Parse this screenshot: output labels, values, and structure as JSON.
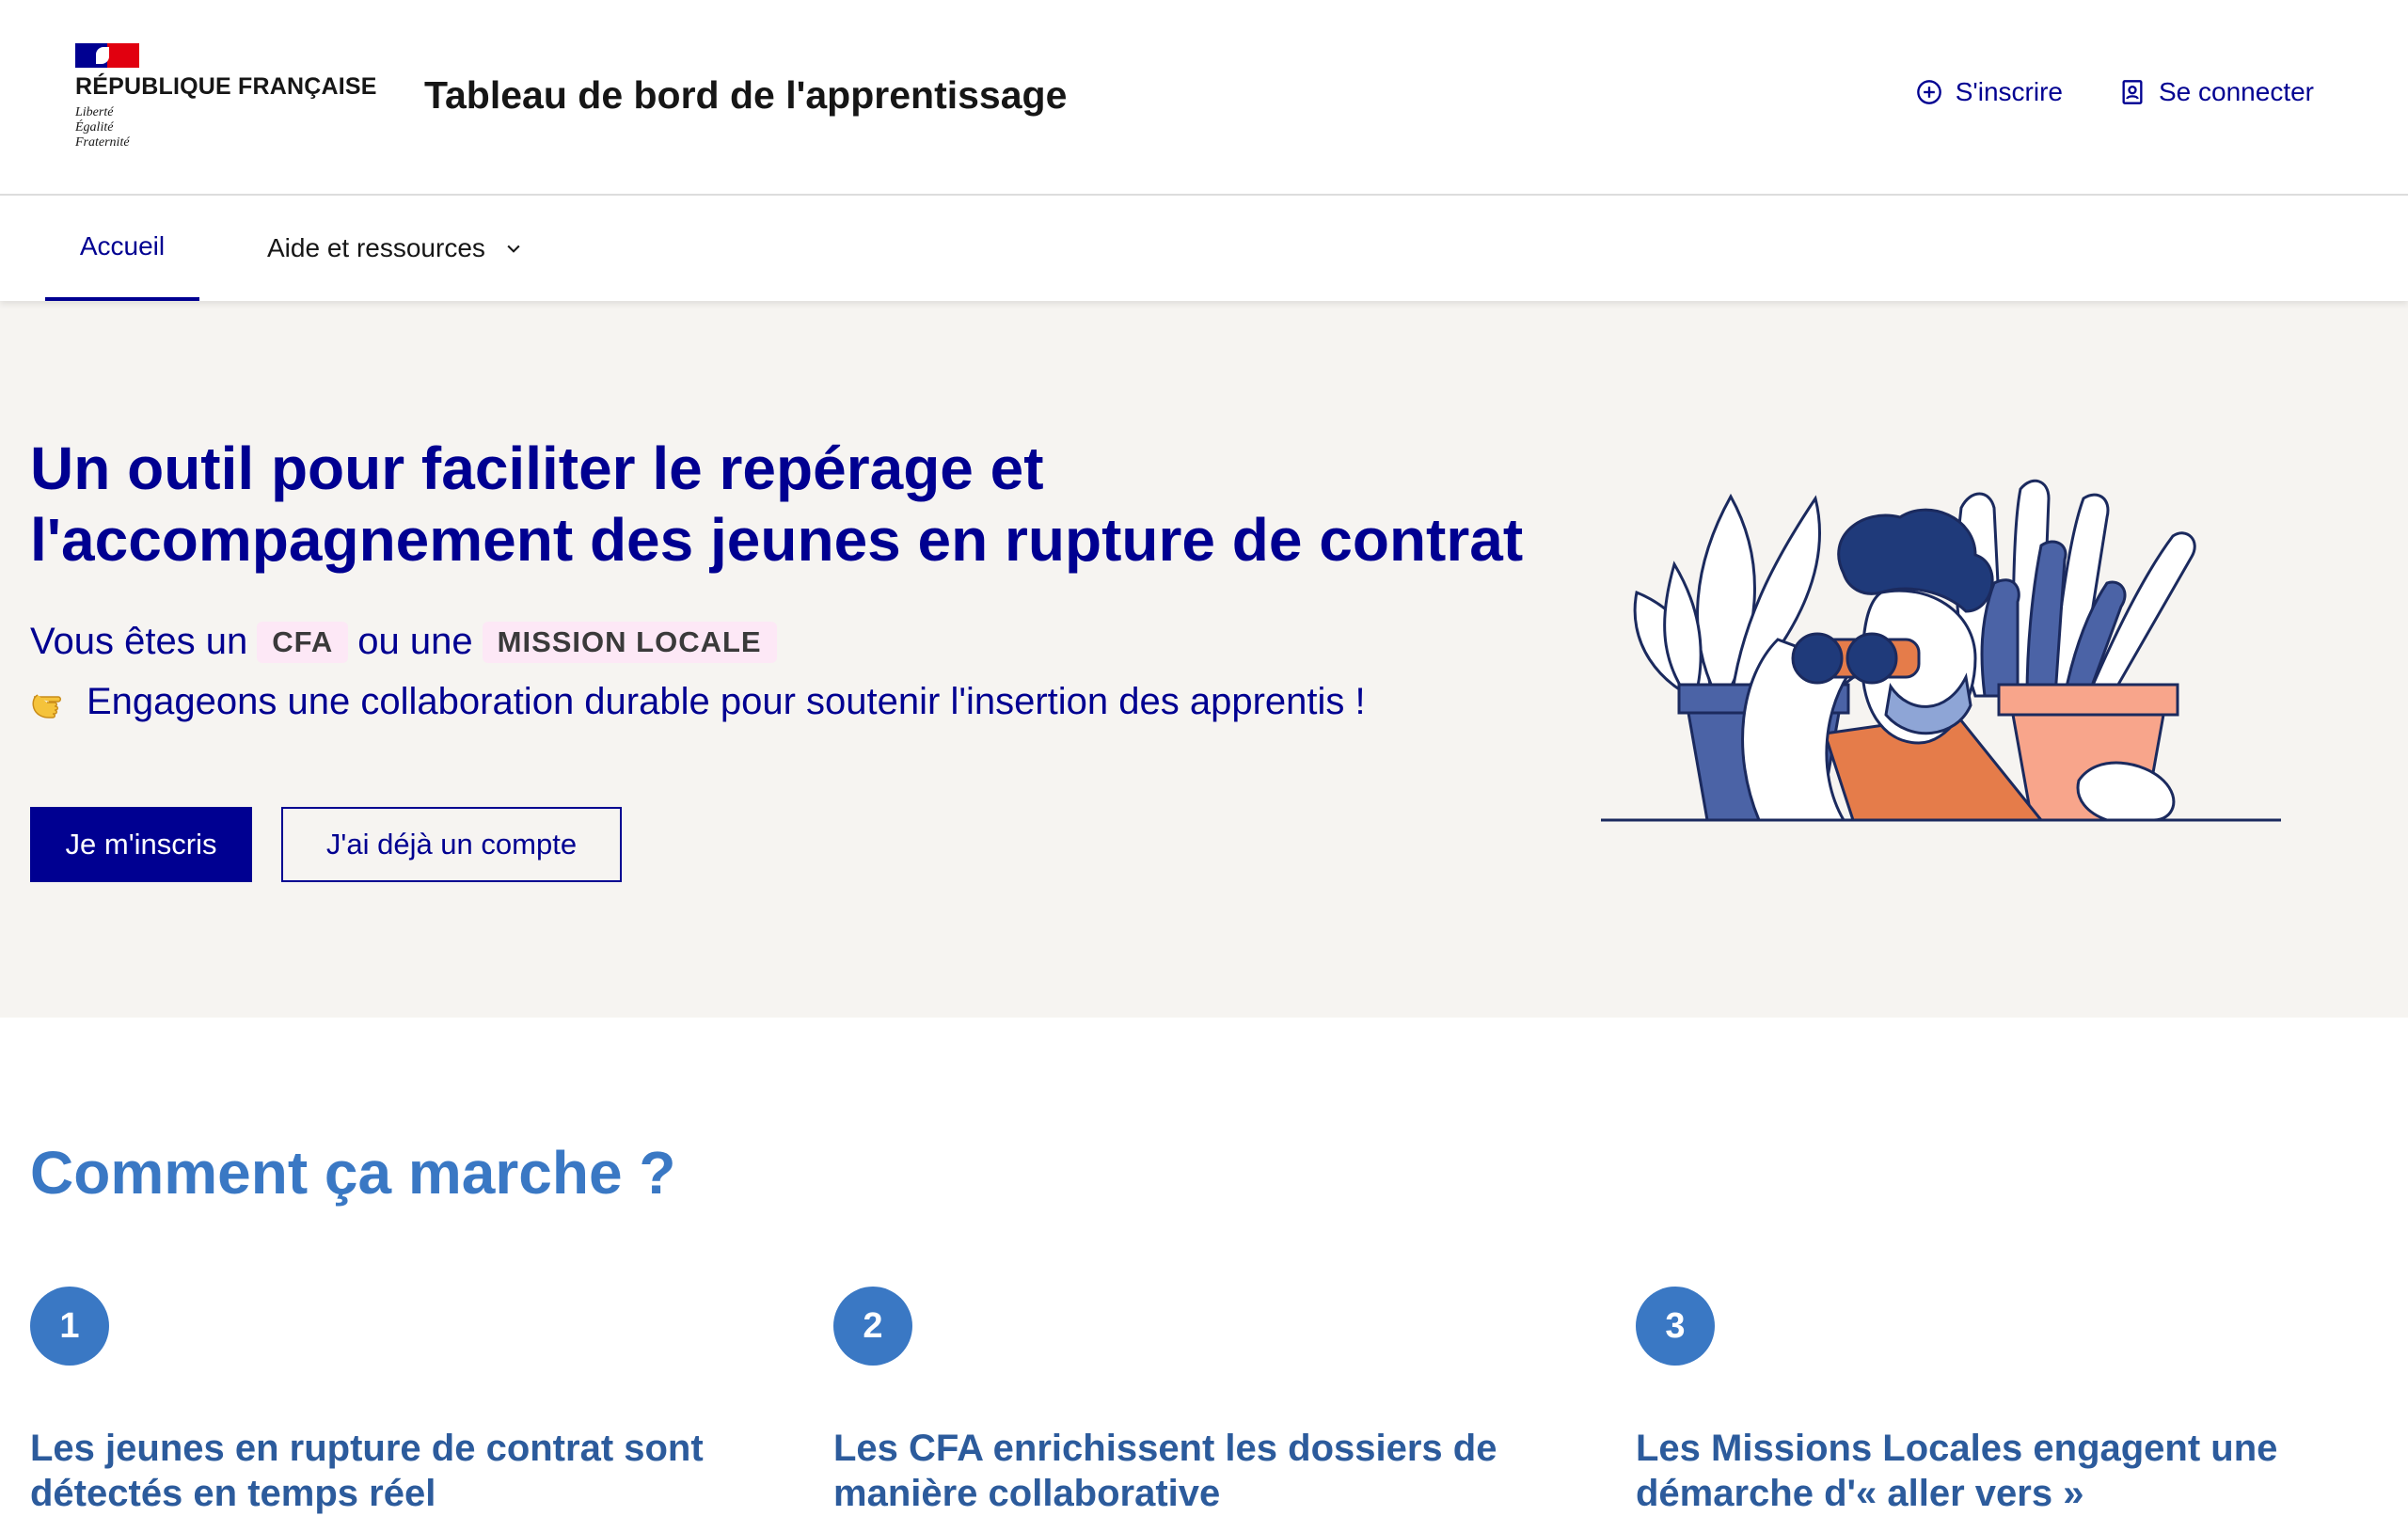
{
  "header": {
    "logo_title": "RÉPUBLIQUE FRANÇAISE",
    "motto": [
      "Liberté",
      "Égalité",
      "Fraternité"
    ],
    "site_title": "Tableau de bord de l'apprentissage",
    "signup_label": "S'inscrire",
    "login_label": "Se connecter"
  },
  "nav": {
    "items": [
      {
        "label": "Accueil",
        "active": true
      },
      {
        "label": "Aide et ressources",
        "has_dropdown": true
      }
    ]
  },
  "hero": {
    "title_lines": [
      "Un outil pour faciliter le repérage et",
      "l'accompagnement des jeunes en rupture de contrat"
    ],
    "line1_prefix": "Vous êtes un",
    "tag_cfa": "CFA",
    "line1_middle": "ou une",
    "tag_mission": "MISSION LOCALE",
    "line2": "Engageons une collaboration durable pour soutenir l'insertion des apprentis !",
    "primary_button": "Je m'inscris",
    "secondary_button": "J'ai déjà un compte"
  },
  "how": {
    "title": "Comment ça marche ?",
    "steps": [
      {
        "number": "1",
        "title": "Les jeunes en rupture de contrat sont détectés en temps réel"
      },
      {
        "number": "2",
        "title": "Les CFA enrichissent les dossiers de manière collaborative"
      },
      {
        "number": "3",
        "title": "Les Missions Locales engagent une démarche d'« aller vers »"
      }
    ]
  },
  "colors": {
    "brand_blue": "#000091",
    "brand_red": "#e1000f",
    "hero_bg": "#f6f4f1",
    "accent_blue": "#3a78c4",
    "tag_bg": "#fde8f6"
  },
  "icons": {
    "signup": "plus-circle-icon",
    "login": "account-icon",
    "dropdown": "chevron-down-icon",
    "pointing": "pointing-hand-icon"
  }
}
